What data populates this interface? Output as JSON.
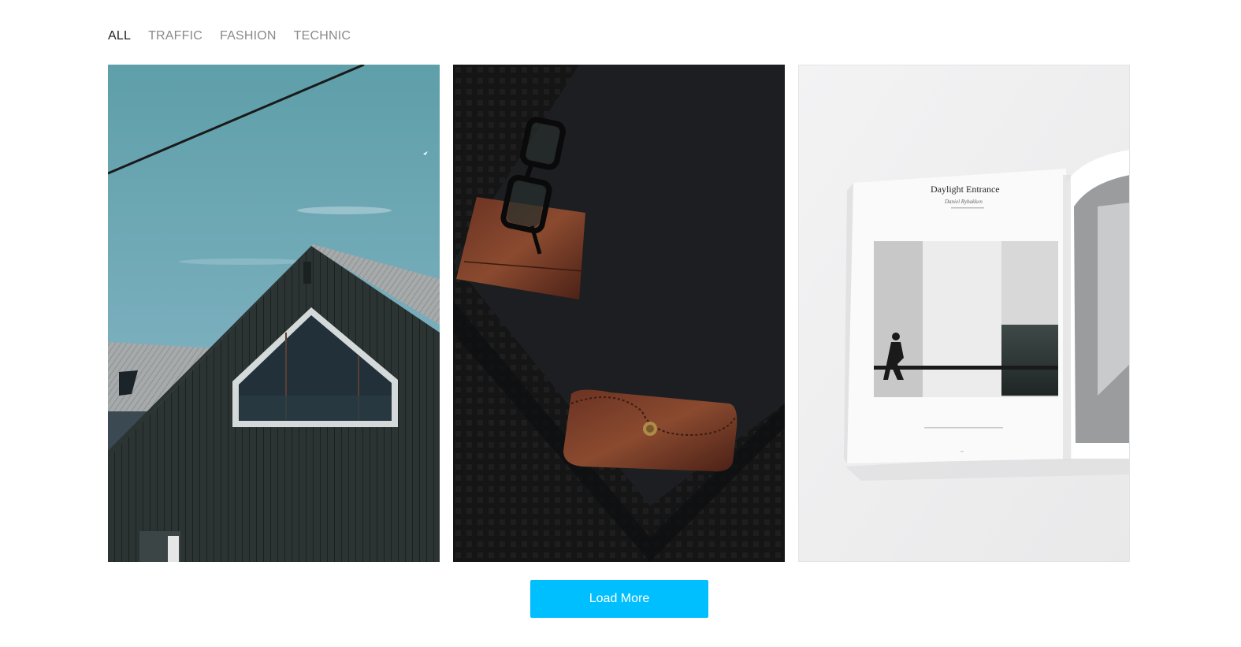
{
  "filters": [
    {
      "label": "ALL",
      "active": true
    },
    {
      "label": "TRAFFIC",
      "active": false
    },
    {
      "label": "FASHION",
      "active": false
    },
    {
      "label": "TECHNIC",
      "active": false
    }
  ],
  "gallery": {
    "items": [
      {
        "subject": "dark wooden house with pentagon window under teal sky"
      },
      {
        "subject": "eyeglasses, leather wallet and leather case on dark laptop"
      },
      {
        "subject": "open magazine spread",
        "magazine_title": "Daylight Entrance",
        "magazine_author": "Daniel Rybakken"
      }
    ]
  },
  "load_more": {
    "label": "Load More"
  },
  "colors": {
    "accent": "#00bfff",
    "active_filter": "#222222",
    "inactive_filter": "#8a8a8a"
  }
}
